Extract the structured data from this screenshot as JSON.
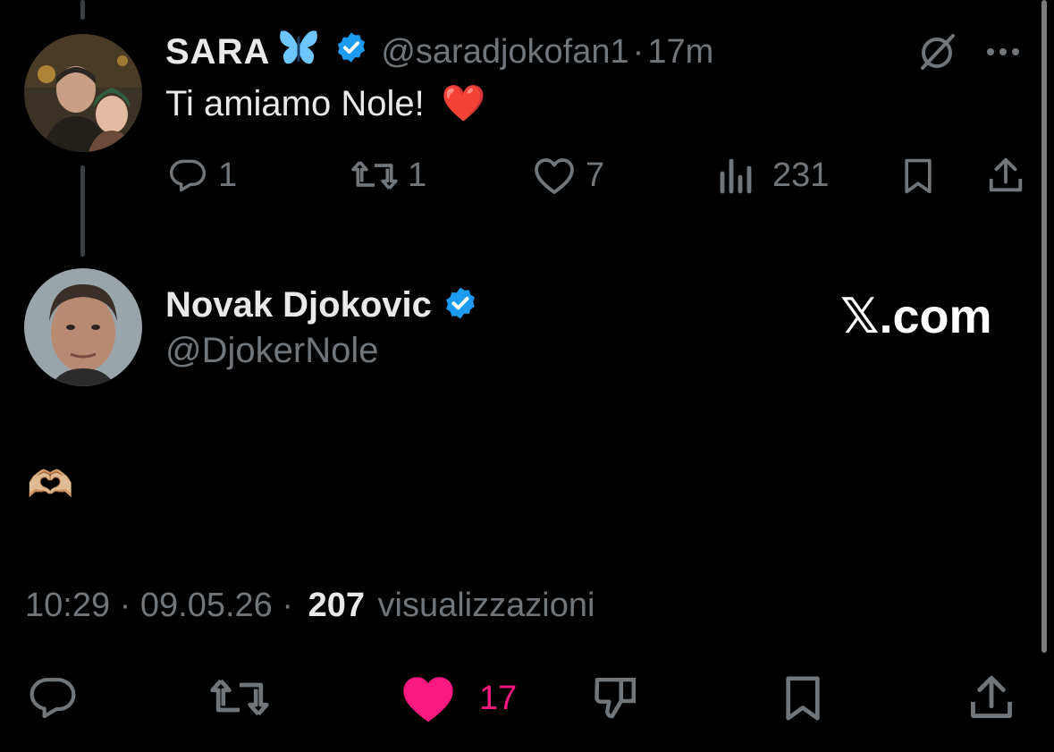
{
  "reply": {
    "display_name": "SARA",
    "handle": "@saradjokofan1",
    "separator": "·",
    "time": "17m",
    "text": "Ti amiamo Nole!",
    "emoji": "❤️",
    "stats": {
      "replies": "1",
      "reposts": "1",
      "likes": "7",
      "views": "231"
    }
  },
  "main": {
    "display_name": "Novak Djokovic",
    "handle": "@DjokerNole",
    "watermark": "𝕏.com",
    "text": "🫶🏼",
    "timestamp": "10:29 · 09.05.26 ·",
    "views_count": "207",
    "views_label": "visualizzazioni",
    "like_count": "17"
  },
  "colors": {
    "background": "#000000",
    "text": "#e7e9ea",
    "muted": "#71767b",
    "verified": "#1d9bf0",
    "liked": "#f91880"
  }
}
